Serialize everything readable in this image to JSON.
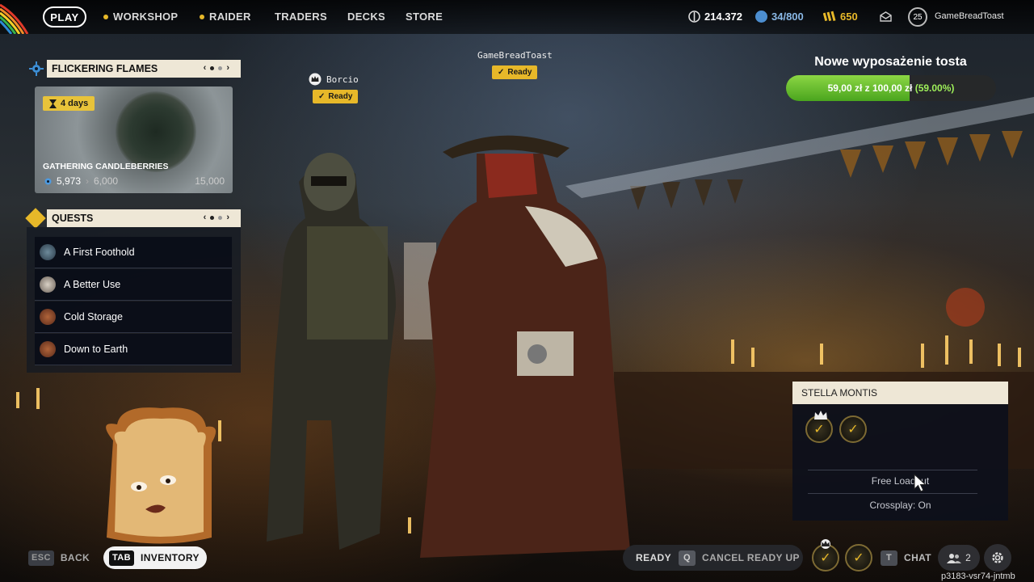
{
  "nav": {
    "play": "PLAY",
    "workshop": "WORKSHOP",
    "raider": "RAIDER",
    "traders": "TRADERS",
    "decks": "DECKS",
    "store": "STORE"
  },
  "currencies": {
    "coins": "214.372",
    "raider_tokens": "34/800",
    "credits": "650"
  },
  "profile": {
    "level": "25",
    "name": "GameBreadToast"
  },
  "event": {
    "header": "FLICKERING FLAMES",
    "timer": "4 days",
    "title": "GATHERING CANDLEBERRIES",
    "progress": "5,973",
    "milestone": "6,000",
    "max": "15,000",
    "prev": "‹",
    "next": "›"
  },
  "quests": {
    "header": "QUESTS",
    "prev": "‹",
    "next": "›",
    "items": [
      {
        "label": "A First Foothold"
      },
      {
        "label": "A Better Use"
      },
      {
        "label": "Cold Storage"
      },
      {
        "label": "Down to Earth"
      }
    ]
  },
  "party": [
    {
      "name": "Borcio",
      "status": "Ready"
    },
    {
      "name": "GameBreadToast",
      "status": "Ready"
    }
  ],
  "goal": {
    "title": "Nowe wyposażenie tosta",
    "current": "59,00 zł",
    "separator": "z",
    "target": "100,00 zł",
    "percent_label": "(59.00%)",
    "fraction": 0.59
  },
  "squad": {
    "header": "STELLA MONTIS",
    "loadout": "Free Loadout",
    "crossplay": "Crossplay: On"
  },
  "bottom": {
    "esc_key": "ESC",
    "back": "BACK",
    "tab_key": "TAB",
    "inventory": "INVENTORY",
    "ready": "READY",
    "q_key": "Q",
    "cancel_ready": "CANCEL READY UP",
    "t_key": "T",
    "chat": "CHAT",
    "friends_count": "2"
  },
  "watermark": "p3183-vsr74-jntmb",
  "colors": {
    "accent_yellow": "#e7b829",
    "goal_green": "#6cc030",
    "panel_cream": "#eee7d6"
  }
}
